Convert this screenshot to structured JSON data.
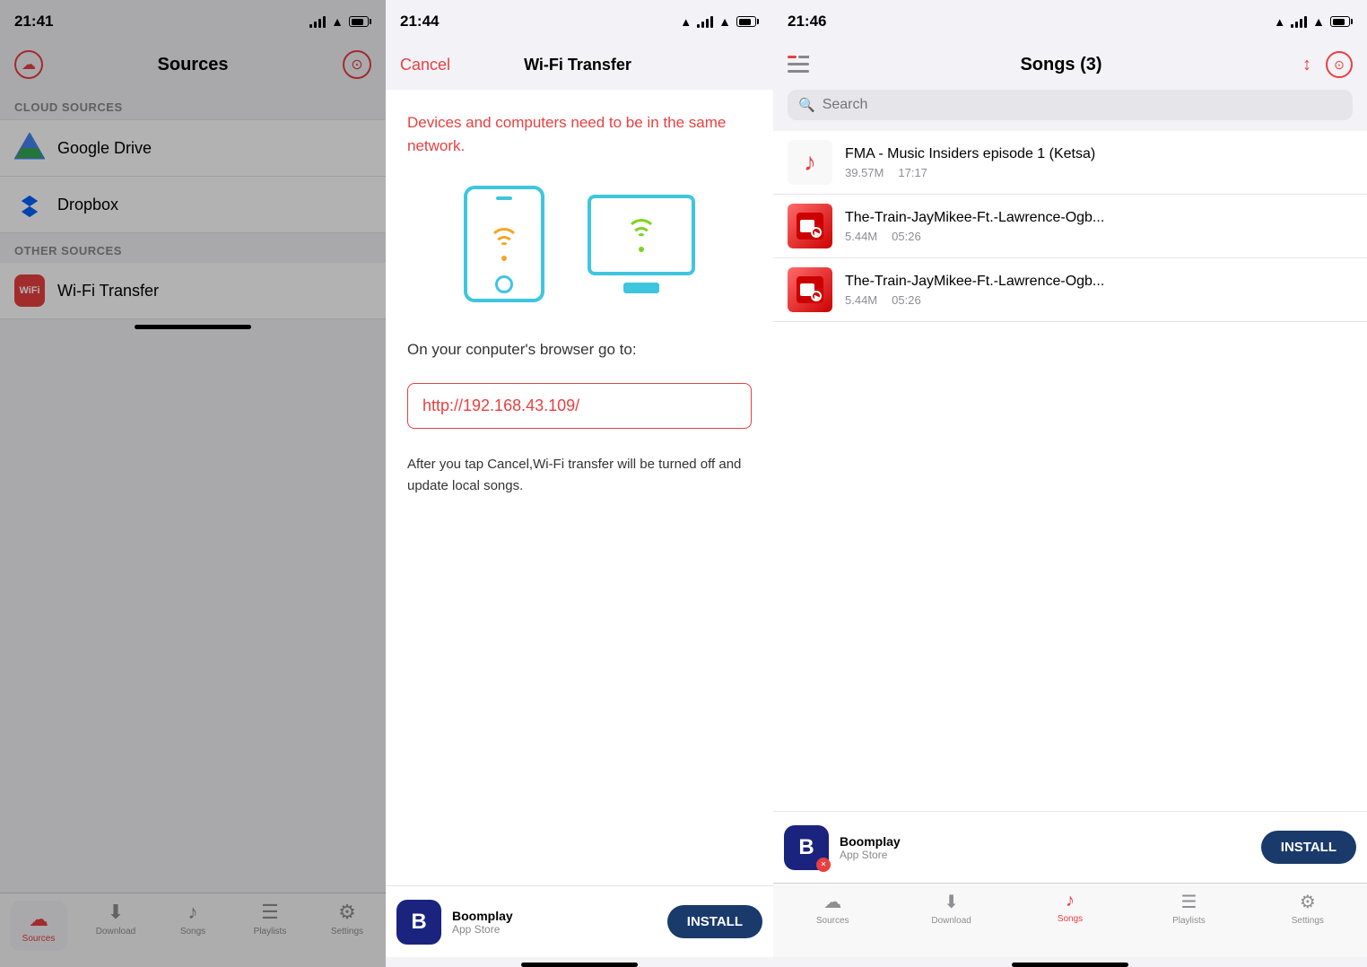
{
  "panel1": {
    "statusBar": {
      "time": "21:41",
      "icons": [
        "signal",
        "wifi",
        "battery"
      ]
    },
    "header": {
      "title": "Sources"
    },
    "sections": [
      {
        "label": "Cloud Sources",
        "items": [
          {
            "id": "google-drive",
            "label": "Google Drive"
          },
          {
            "id": "dropbox",
            "label": "Dropbox"
          }
        ]
      },
      {
        "label": "Other Sources",
        "items": [
          {
            "id": "wifi-transfer",
            "label": "Wi-Fi Transfer"
          }
        ]
      }
    ],
    "tabBar": {
      "items": [
        {
          "id": "sources",
          "label": "Sources",
          "active": true
        },
        {
          "id": "download",
          "label": "Download",
          "active": false
        },
        {
          "id": "songs",
          "label": "Songs",
          "active": false
        },
        {
          "id": "playlists",
          "label": "Playlists",
          "active": false
        },
        {
          "id": "settings",
          "label": "Settings",
          "active": false
        }
      ]
    }
  },
  "panel2": {
    "statusBar": {
      "time": "21:44"
    },
    "header": {
      "cancelLabel": "Cancel",
      "title": "Wi-Fi Transfer"
    },
    "warningText": "Devices and computers need to be in the same network.",
    "instructionText": "On your conputer's browser go to:",
    "urlText": "http://192.168.43.109/",
    "footerText": "After you tap Cancel,Wi-Fi transfer will be turned off and update local songs.",
    "adBanner": {
      "appName": "Boomplay",
      "storeName": "App Store",
      "installLabel": "INSTALL"
    }
  },
  "panel3": {
    "statusBar": {
      "time": "21:46"
    },
    "header": {
      "title": "Songs (3)"
    },
    "searchPlaceholder": "Search",
    "songs": [
      {
        "title": "FMA - Music Insiders episode 1 (Ketsa)",
        "size": "39.57M",
        "duration": "17:17",
        "type": "music"
      },
      {
        "title": "The-Train-JayMikee-Ft.-Lawrence-Ogb...",
        "size": "5.44M",
        "duration": "05:26",
        "type": "video"
      },
      {
        "title": "The-Train-JayMikee-Ft.-Lawrence-Ogb...",
        "size": "5.44M",
        "duration": "05:26",
        "type": "video"
      }
    ],
    "tabBar": {
      "items": [
        {
          "id": "sources",
          "label": "Sources",
          "active": false
        },
        {
          "id": "download",
          "label": "Download",
          "active": false
        },
        {
          "id": "songs",
          "label": "Songs",
          "active": true
        },
        {
          "id": "playlists",
          "label": "Playlists",
          "active": false
        },
        {
          "id": "settings",
          "label": "Settings",
          "active": false
        }
      ]
    },
    "adBanner": {
      "appName": "Boomplay",
      "storeName": "App Store",
      "installLabel": "INSTALL"
    }
  }
}
